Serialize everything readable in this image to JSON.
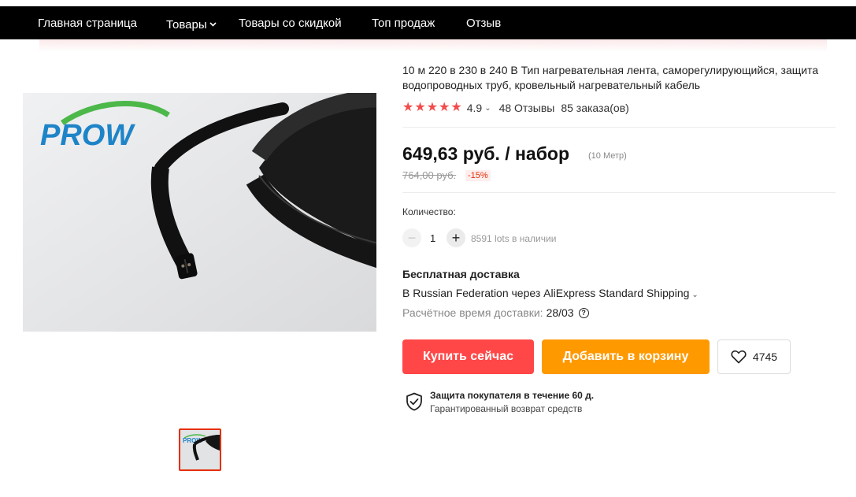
{
  "nav": {
    "items": [
      {
        "label": "Главная страница"
      },
      {
        "label": "Товары"
      },
      {
        "label": "Товары со скидкой"
      },
      {
        "label": "Топ продаж"
      },
      {
        "label": "Отзыв"
      }
    ]
  },
  "gallery": {
    "brand_logo": "PROW",
    "thumbnails_count": 1
  },
  "product": {
    "title": "10 м 220 в 230 в 240 В Тип нагревательная лента, саморегулирующийся, защита водопроводных труб, кровельный нагревательный кабель",
    "rating": "4.9",
    "reviews": "48 Отзывы",
    "orders": "85 заказа(ов)",
    "price": "649,63 руб. / набор",
    "price_unit": "(10 Метр)",
    "old_price": "764,00 руб.",
    "discount": "-15%"
  },
  "quantity": {
    "label": "Количество:",
    "value": "1",
    "stock": "8591 lots в наличии"
  },
  "shipping": {
    "title": "Бесплатная доставка",
    "via": "В Russian Federation через AliExpress Standard Shipping",
    "eta_label": "Расчётное время доставки:",
    "eta_date": "28/03"
  },
  "actions": {
    "buy_now": "Купить сейчас",
    "add_to_cart": "Добавить в корзину",
    "wishlist_count": "4745"
  },
  "protection": {
    "title": "Защита покупателя в течение 60 д.",
    "subtitle": "Гарантированный возврат средств"
  },
  "colors": {
    "nav_bg": "#000000",
    "star": "#f44b4b",
    "buy_btn": "#ff4747",
    "cart_btn": "#ff9900",
    "discount": "#e62e04"
  }
}
